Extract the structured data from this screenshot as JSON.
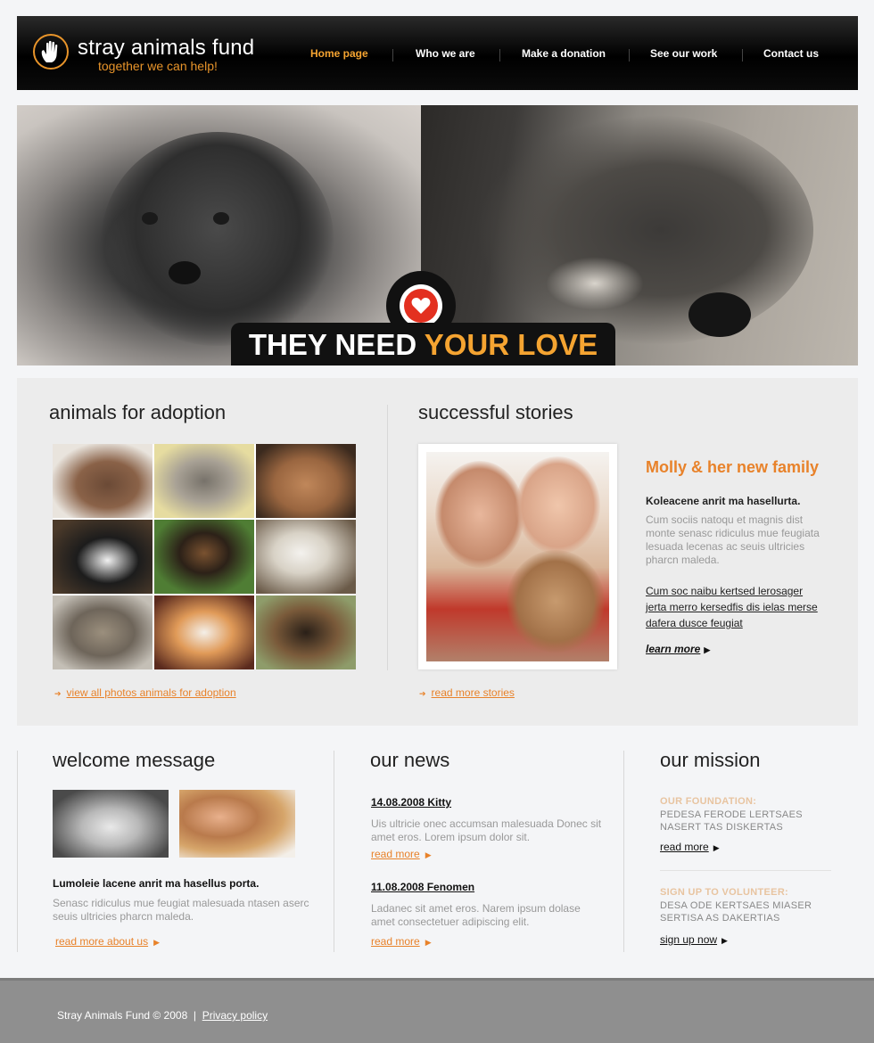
{
  "brand": {
    "title": "stray animals fund",
    "tagline": "together we can help!",
    "accent": "#e8942a"
  },
  "nav": {
    "items": [
      {
        "label": "Home page",
        "active": true
      },
      {
        "label": "Who we are",
        "active": false
      },
      {
        "label": "Make a donation",
        "active": false
      },
      {
        "label": "See our work",
        "active": false
      },
      {
        "label": "Contact us",
        "active": false
      }
    ]
  },
  "hero": {
    "slogan_main": "THEY NEED ",
    "slogan_accent": "YOUR LOVE",
    "badge_icon": "heart-icon"
  },
  "adoption": {
    "title": "animals for adoption",
    "link": "view all photos animals for adoption",
    "photos": [
      "dog",
      "kitten",
      "rabbit",
      "kitten",
      "german-shepherd",
      "puppy",
      "tabby-cat",
      "ginger-kitten",
      "puppy"
    ]
  },
  "stories": {
    "title": "successful stories",
    "headline": "Molly & her new family",
    "subtitle": "Koleacene anrit ma hasellurta.",
    "body": "Cum sociis natoqu et magnis dist monte senasc ridiculus mue feugiata lesuada lecenas ac seuis ultricies pharcn maleda.",
    "links": [
      "Cum soc naibu kertsed lerosager",
      "jerta merro kersedfis dis ielas merse",
      "dafera dusce feugiat"
    ],
    "learn_more": "learn more",
    "read_more": "read more stories"
  },
  "welcome": {
    "title": "welcome message",
    "bold": "Lumoleie lacene anrit ma hasellus porta.",
    "body": "Senasc ridiculus mue feugiat malesuada ntasen aserc seuis ultricies pharcn maleda.",
    "link": "read more about us"
  },
  "news": {
    "title": "our news",
    "items": [
      {
        "date": "14.08.2008 Kitty",
        "body": "Uis ultricie onec accumsan malesuada Donec sit amet eros. Lorem ipsum dolor sit.",
        "link": "read more"
      },
      {
        "date": "11.08.2008 Fenomen",
        "body": "Ladanec sit amet eros. Narem ipsum dolase amet consectetuer adipiscing elit.",
        "link": "read more"
      }
    ]
  },
  "mission": {
    "title": "our mission",
    "blocks": [
      {
        "head": "OUR FOUNDATION:",
        "body": "PEDESA FERODE LERTSAES NASERT TAS DISKERTAS",
        "link": "read more"
      },
      {
        "head": "SIGN UP TO VOLUNTEER:",
        "body": "DESA ODE KERTSAES MIASER SERTISA AS DAKERTIAS",
        "link": "sign up now"
      }
    ]
  },
  "footer": {
    "copyright": "Stray Animals Fund © 2008",
    "separator": "|",
    "privacy": "Privacy policy"
  },
  "colors": {
    "accent_orange": "#e8822a",
    "nav_active": "#f5a431",
    "heart_red": "#e33020"
  }
}
